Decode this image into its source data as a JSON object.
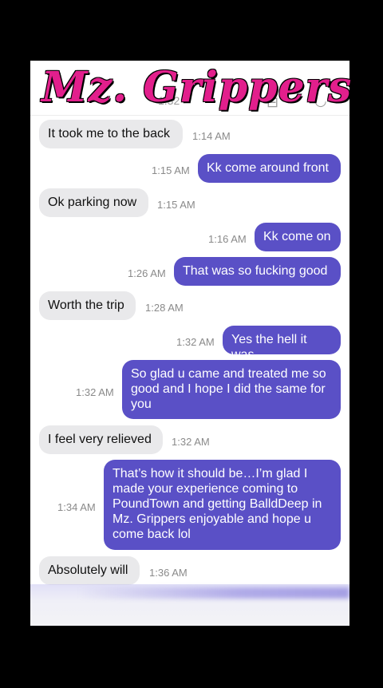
{
  "header": {
    "brand_title": "Mz. Grippers",
    "ghost_time": "1:32",
    "icon_left": "compose-icon",
    "icon_right": "video-icon"
  },
  "colors": {
    "outgoing_bubble": "#5a50c6",
    "incoming_bubble": "#e9e9eb",
    "brand": "#e21f8c"
  },
  "messages": [
    {
      "direction": "in",
      "text": "It took me to the back",
      "time": "1:14 AM"
    },
    {
      "direction": "out",
      "text": "Kk come around front",
      "time": "1:15 AM"
    },
    {
      "direction": "in",
      "text": "Ok parking now",
      "time": "1:15 AM"
    },
    {
      "direction": "out",
      "text": "Kk come on",
      "time": "1:16 AM"
    },
    {
      "direction": "out",
      "text": "That was so fucking good",
      "time": "1:26 AM"
    },
    {
      "direction": "in",
      "text": "Worth the trip",
      "time": "1:28 AM"
    },
    {
      "direction": "out",
      "text": "Yes the hell it was",
      "time": "1:32 AM"
    },
    {
      "direction": "out",
      "text": "So glad u came and treated me so good and I hope I did the same for you",
      "time": "1:32 AM"
    },
    {
      "direction": "in",
      "text": "I feel very relieved",
      "time": "1:32 AM"
    },
    {
      "direction": "out",
      "text": "That’s how it should be…I’m glad I made your experience coming to PoundTown and getting BalldDeep in Mz. Grippers enjoyable and hope u come back lol",
      "time": "1:34 AM"
    },
    {
      "direction": "in",
      "text": "Absolutely will",
      "time": "1:36 AM"
    }
  ]
}
